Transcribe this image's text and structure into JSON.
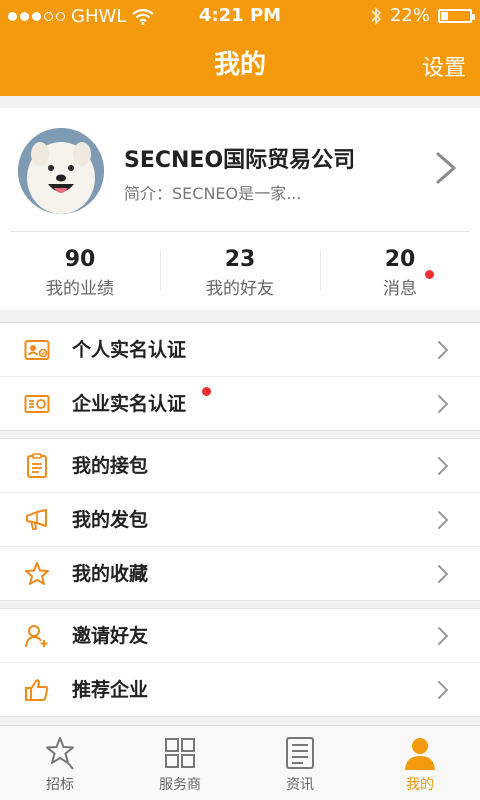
{
  "status_bar": {
    "carrier": "GHWL",
    "time": "4:21 PM",
    "battery": "22%"
  },
  "nav": {
    "title": "我的",
    "right_action": "设置"
  },
  "profile": {
    "company": "SECNEO国际贸易公司",
    "intro": "简介：SECNEO是一家..."
  },
  "stats": [
    {
      "value": "90",
      "label": "我的业绩"
    },
    {
      "value": "23",
      "label": "我的好友"
    },
    {
      "value": "20",
      "label": "消息",
      "badge": true
    }
  ],
  "groups": [
    {
      "items": [
        {
          "label": "个人实名认证",
          "icon": "id-card-icon"
        },
        {
          "label": "企业实名认证",
          "icon": "certificate-icon",
          "badge": true
        }
      ]
    },
    {
      "items": [
        {
          "label": "我的接包",
          "icon": "clipboard-icon"
        },
        {
          "label": "我的发包",
          "icon": "megaphone-icon"
        },
        {
          "label": "我的收藏",
          "icon": "star-icon"
        }
      ]
    },
    {
      "items": [
        {
          "label": "邀请好友",
          "icon": "add-user-icon"
        },
        {
          "label": "推荐企业",
          "icon": "thumbs-up-icon"
        }
      ]
    }
  ],
  "tabs": [
    {
      "label": "招标",
      "icon": "star-pin-icon"
    },
    {
      "label": "服务商",
      "icon": "grid-icon"
    },
    {
      "label": "资讯",
      "icon": "news-icon"
    },
    {
      "label": "我的",
      "icon": "person-icon",
      "active": true
    }
  ],
  "colors": {
    "accent": "#f49a0c",
    "badge": "#f03030"
  }
}
